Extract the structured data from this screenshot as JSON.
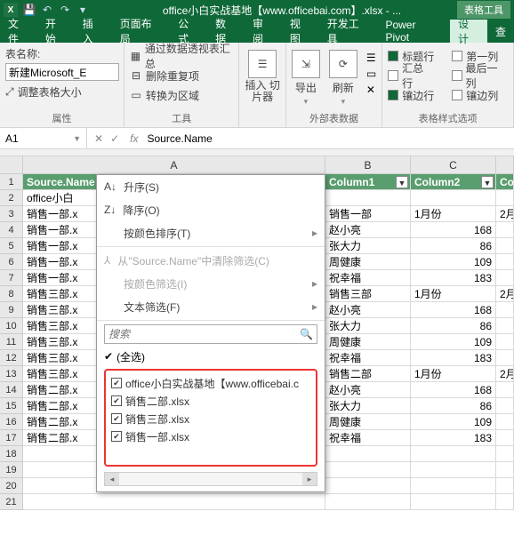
{
  "titlebar": {
    "logo": "X",
    "title": "office小白实战基地【www.officebai.com】.xlsx - ...",
    "tool_context": "表格工具"
  },
  "menu": {
    "tabs": [
      "文件",
      "开始",
      "插入",
      "页面布局",
      "公式",
      "数据",
      "审阅",
      "视图",
      "开发工具",
      "Power Pivot"
    ],
    "design": "设计",
    "search": "查"
  },
  "ribbon": {
    "g1": {
      "label": "表名称:",
      "value": "新建Microsoft_E",
      "resize": "调整表格大小",
      "group": "属性"
    },
    "g2": {
      "pivot": "通过数据透视表汇总",
      "dedup": "删除重复项",
      "range": "转换为区域",
      "group": "工具"
    },
    "g3": {
      "slicer": "插入\n切片器"
    },
    "g4": {
      "export": "导出",
      "refresh": "刷新",
      "group": "外部表数据"
    },
    "g5": {
      "hdr": "标题行",
      "col1": "第一列",
      "tot": "汇总行",
      "coln": "最后一列",
      "band": "镶边行",
      "bandc": "镶边列",
      "group": "表格样式选项"
    }
  },
  "fbar": {
    "name": "A1",
    "fx": "fx",
    "value": "Source.Name"
  },
  "cols": {
    "A": "A",
    "B": "B",
    "C": "C",
    "D": ""
  },
  "headers": {
    "src": "Source.Name",
    "c1": "Column1",
    "c2": "Column2",
    "c3": "Col"
  },
  "rows": [
    {
      "n": 1
    },
    {
      "n": 2,
      "a": "office小白",
      "b": "",
      "c": ""
    },
    {
      "n": 3,
      "a": "销售一部.x",
      "b": "销售一部",
      "c": "1月份",
      "d": "2月"
    },
    {
      "n": 4,
      "a": "销售一部.x",
      "b": "赵小亮",
      "c": "168"
    },
    {
      "n": 5,
      "a": "销售一部.x",
      "b": "张大力",
      "c": "86"
    },
    {
      "n": 6,
      "a": "销售一部.x",
      "b": "周健康",
      "c": "109"
    },
    {
      "n": 7,
      "a": "销售一部.x",
      "b": "祝幸福",
      "c": "183"
    },
    {
      "n": 8,
      "a": "销售三部.x",
      "b": "销售三部",
      "c": "1月份",
      "d": "2月"
    },
    {
      "n": 9,
      "a": "销售三部.x",
      "b": "赵小亮",
      "c": "168"
    },
    {
      "n": 10,
      "a": "销售三部.x",
      "b": "张大力",
      "c": "86"
    },
    {
      "n": 11,
      "a": "销售三部.x",
      "b": "周健康",
      "c": "109"
    },
    {
      "n": 12,
      "a": "销售三部.x",
      "b": "祝幸福",
      "c": "183"
    },
    {
      "n": 13,
      "a": "销售三部.x",
      "b": "销售二部",
      "c": "1月份",
      "d": "2月"
    },
    {
      "n": 14,
      "a": "销售二部.x",
      "b": "赵小亮",
      "c": "168"
    },
    {
      "n": 15,
      "a": "销售二部.x",
      "b": "张大力",
      "c": "86"
    },
    {
      "n": 16,
      "a": "销售二部.x",
      "b": "周健康",
      "c": "109"
    },
    {
      "n": 17,
      "a": "销售二部.x",
      "b": "祝幸福",
      "c": "183"
    },
    {
      "n": 18,
      "a": ""
    },
    {
      "n": 19,
      "a": ""
    },
    {
      "n": 20,
      "a": ""
    },
    {
      "n": 21,
      "a": ""
    }
  ],
  "filter": {
    "asc": "升序(S)",
    "desc": "降序(O)",
    "bycolor": "按颜色排序(T)",
    "clear_pre": "从\"",
    "clear_field": "Source.Name",
    "clear_suf": "\"中清除筛选(C)",
    "filtercolor": "按颜色筛选(I)",
    "textfilter": "文本筛选(F)",
    "search": "搜索",
    "all": "(全选)",
    "items": [
      "office小白实战基地【www.officebai.c",
      "销售二部.xlsx",
      "销售三部.xlsx",
      "销售一部.xlsx"
    ]
  }
}
